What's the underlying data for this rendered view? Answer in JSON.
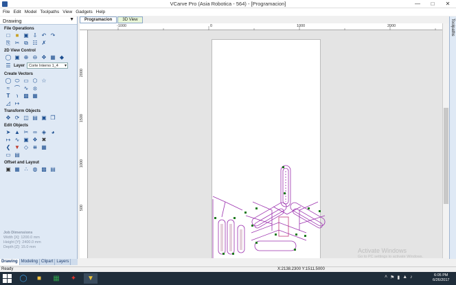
{
  "window": {
    "title": "VCarve Pro (Asia Robotica - 564) - [Programacion]"
  },
  "menu": [
    "File",
    "Edit",
    "Model",
    "Toolpaths",
    "View",
    "Gadgets",
    "Help"
  ],
  "panel": {
    "title": "Drawing",
    "sections": {
      "file_ops": "File Operations",
      "view_control": "2D View Control",
      "create_vectors": "Create Vectors",
      "transform": "Transform Objects",
      "edit": "Edit Objects",
      "offset": "Offset and Layout"
    },
    "layer_label": "Layer",
    "layer_value": "Corte Interno 1_4"
  },
  "job": {
    "heading": "Job Dimensions",
    "width": "Width  [X]: 1200.0 mm",
    "height": "Height [Y]: 2400.0 mm",
    "depth": "Depth  [Z]: 15.0 mm"
  },
  "bottom_tabs": [
    "Drawing",
    "Modeling",
    "Clipart",
    "Layers"
  ],
  "view_tabs": [
    "Programacion",
    "3D View"
  ],
  "right_strip": "Toolpaths",
  "ruler": {
    "h_labels": [
      "-1000",
      "0",
      "1000",
      "2000"
    ],
    "v_labels": [
      "2000",
      "1500",
      "1000",
      "500"
    ]
  },
  "status": {
    "text": "Ready",
    "coords": "X:2138.2300 Y:1511.5000"
  },
  "watermark": {
    "line1": "Activate Windows",
    "line2": "Go to PC settings to activate Windows."
  },
  "clock": {
    "time": "6:05 PM",
    "date": "6/26/2017"
  },
  "colors": {
    "toolpath_purple": "#9b2fae",
    "vector_green": "#1e7a1e",
    "panel_bg": "#dfe9f5"
  }
}
